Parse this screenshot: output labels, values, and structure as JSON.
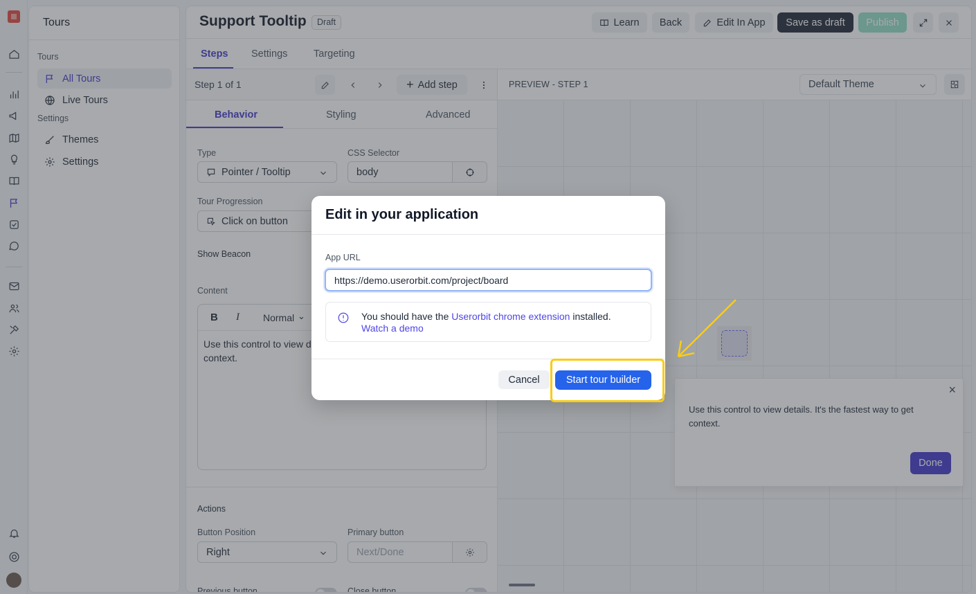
{
  "sidebar": {
    "title": "Tours",
    "section_tours": "Tours",
    "section_settings": "Settings",
    "items": [
      {
        "label": "All Tours"
      },
      {
        "label": "Live Tours"
      },
      {
        "label": "Themes"
      },
      {
        "label": "Settings"
      }
    ]
  },
  "header": {
    "title": "Support Tooltip",
    "badge": "Draft",
    "learn": "Learn",
    "back": "Back",
    "edit_in_app": "Edit In App",
    "save_draft": "Save as draft",
    "publish": "Publish"
  },
  "tabs": [
    "Steps",
    "Settings",
    "Targeting"
  ],
  "editor": {
    "step_label": "Step 1 of 1",
    "add_step": "Add step",
    "subtabs": [
      "Behavior",
      "Styling",
      "Advanced"
    ],
    "type_label": "Type",
    "type_value": "Pointer / Tooltip",
    "css_label": "CSS Selector",
    "css_value": "body",
    "progression_label": "Tour Progression",
    "progression_value": "Click on button",
    "beacon_label": "Show Beacon",
    "content_label": "Content",
    "format_value": "Normal",
    "content_text": "Use this control to view d\ncontext.",
    "actions_label": "Actions",
    "button_position_label": "Button Position",
    "button_position_value": "Right",
    "primary_button_label": "Primary button",
    "primary_button_placeholder": "Next/Done",
    "previous_button_label": "Previous button",
    "close_button_label": "Close button"
  },
  "preview": {
    "label": "PREVIEW - STEP 1",
    "theme": "Default Theme",
    "tooltip_text": "Use this control to view details. It's the fastest way to get context.",
    "done": "Done"
  },
  "modal": {
    "title": "Edit in your application",
    "url_label": "App URL",
    "url_value": "https://demo.userorbit.com/project/board",
    "info_prefix": "You should have the ",
    "info_link": "Userorbit chrome extension",
    "info_suffix": " installed.",
    "demo_link": "Watch a demo",
    "cancel": "Cancel",
    "start": "Start tour builder"
  },
  "colors": {
    "accent": "#4338ca",
    "primary_blue": "#2563eb",
    "highlight": "#facc15",
    "logo": "#e0483e"
  }
}
